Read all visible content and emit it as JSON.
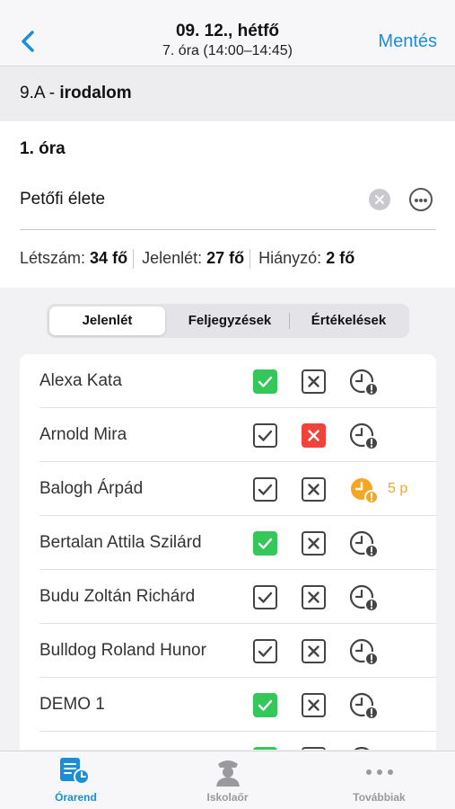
{
  "header": {
    "title": "09. 12., hétfő",
    "subtitle": "7. óra (14:00–14:45)",
    "save_label": "Mentés"
  },
  "class_info": {
    "class": "9.A",
    "dash": " - ",
    "subject": "irodalom"
  },
  "lesson": {
    "number_label": "1. óra",
    "topic": "Petőfi élete",
    "stats": {
      "headcount_label": "Létszám:",
      "headcount_value": "34 fő",
      "present_label": "Jelenlét:",
      "present_value": "27 fő",
      "absent_label": "Hiányzó:",
      "absent_value": "2 fő"
    }
  },
  "tabs": [
    "Jelenlét",
    "Feljegyzések",
    "Értékelések"
  ],
  "students": [
    {
      "name": "Alexa Kata",
      "present": true,
      "absent": false,
      "late": false,
      "late_text": ""
    },
    {
      "name": "Arnold Mira",
      "present": false,
      "absent": true,
      "late": false,
      "late_text": ""
    },
    {
      "name": "Balogh Árpád",
      "present": false,
      "absent": false,
      "late": true,
      "late_text": "5 p"
    },
    {
      "name": "Bertalan Attila Szilárd",
      "present": true,
      "absent": false,
      "late": false,
      "late_text": ""
    },
    {
      "name": "Budu Zoltán Richárd",
      "present": false,
      "absent": false,
      "late": false,
      "late_text": ""
    },
    {
      "name": "Bulldog Roland Hunor",
      "present": false,
      "absent": false,
      "late": false,
      "late_text": ""
    },
    {
      "name": "DEMO 1",
      "present": true,
      "absent": false,
      "late": false,
      "late_text": ""
    }
  ],
  "tabbar": [
    {
      "label": "Órarend",
      "icon": "timetable-icon",
      "active": true
    },
    {
      "label": "Iskolaőr",
      "icon": "school-guard-icon",
      "active": false
    },
    {
      "label": "Továbbiak",
      "icon": "more-icon",
      "active": false
    }
  ],
  "colors": {
    "accent": "#1a8fd8",
    "present": "#34c759",
    "absent": "#f0443a",
    "late": "#f5a623"
  }
}
